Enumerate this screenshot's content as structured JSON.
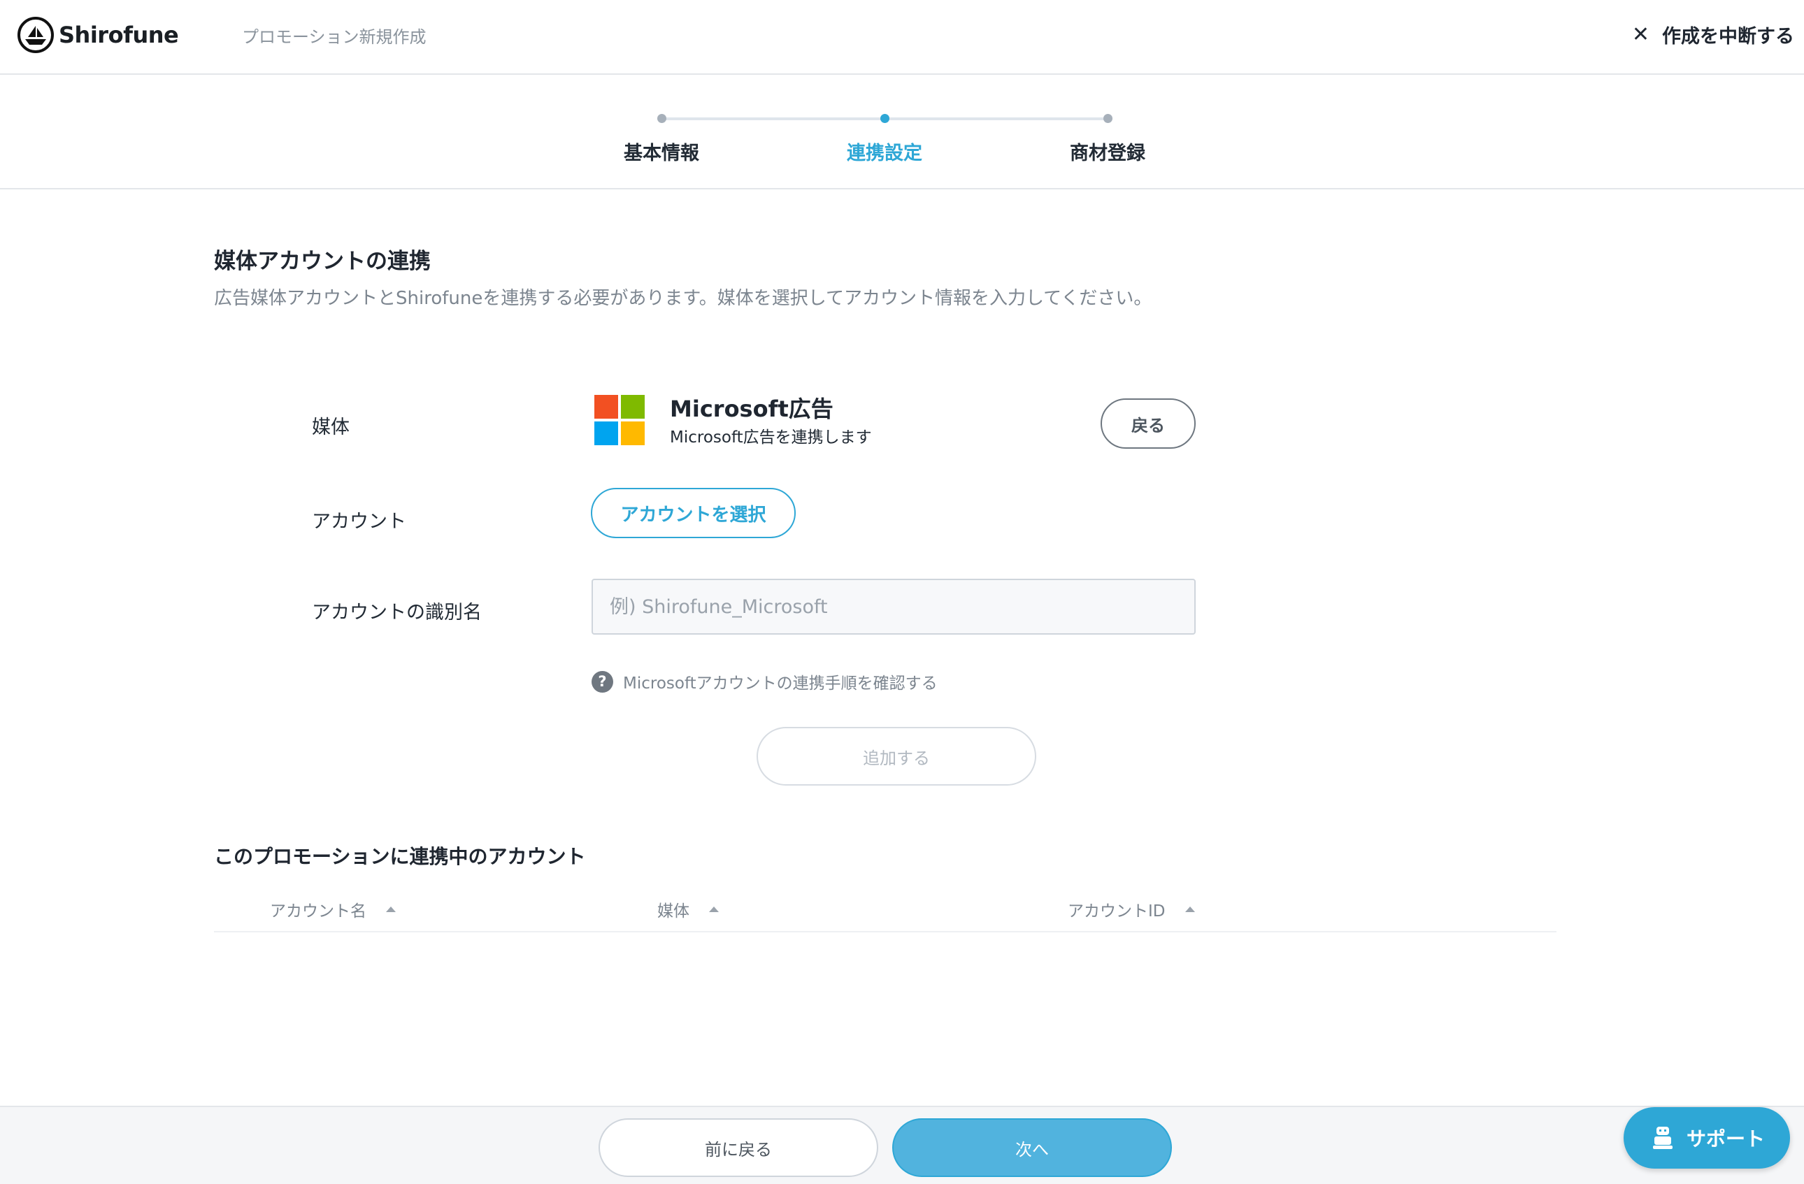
{
  "header": {
    "logo_text": "Shirofune",
    "breadcrumb": "プロモーション新規作成",
    "cancel_label": "作成を中断する",
    "cancel_icon": "close-icon"
  },
  "stepper": {
    "steps": [
      {
        "label": "基本情報",
        "state": "done"
      },
      {
        "label": "連携設定",
        "state": "active"
      },
      {
        "label": "商材登録",
        "state": "upcoming"
      }
    ],
    "accent": "#2ea7d6"
  },
  "section": {
    "title": "媒体アカウントの連携",
    "description": "広告媒体アカウントとShirofuneを連携する必要があります。媒体を選択してアカウント情報を入力してください。"
  },
  "form": {
    "media_label": "媒体",
    "media_name": "Microsoft広告",
    "media_sub": "Microsoft広告を連携します",
    "media_logo_colors": [
      "#f25022",
      "#7fba00",
      "#00a4ef",
      "#ffb900"
    ],
    "back_small_label": "戻る",
    "account_label": "アカウント",
    "select_account_label": "アカウントを選択",
    "account_name_label": "アカウントの識別名",
    "account_name_placeholder": "例) Shirofune_Microsoft",
    "account_name_value": "",
    "help_text": "Microsoftアカウントの連携手順を確認する",
    "help_icon_glyph": "?",
    "add_label": "追加する"
  },
  "linked": {
    "title": "このプロモーションに連携中のアカウント",
    "columns": [
      "アカウント名",
      "媒体",
      "アカウントID"
    ],
    "rows": []
  },
  "footer": {
    "prev_label": "前に戻る",
    "next_label": "次へ",
    "support_label": "サポート"
  }
}
